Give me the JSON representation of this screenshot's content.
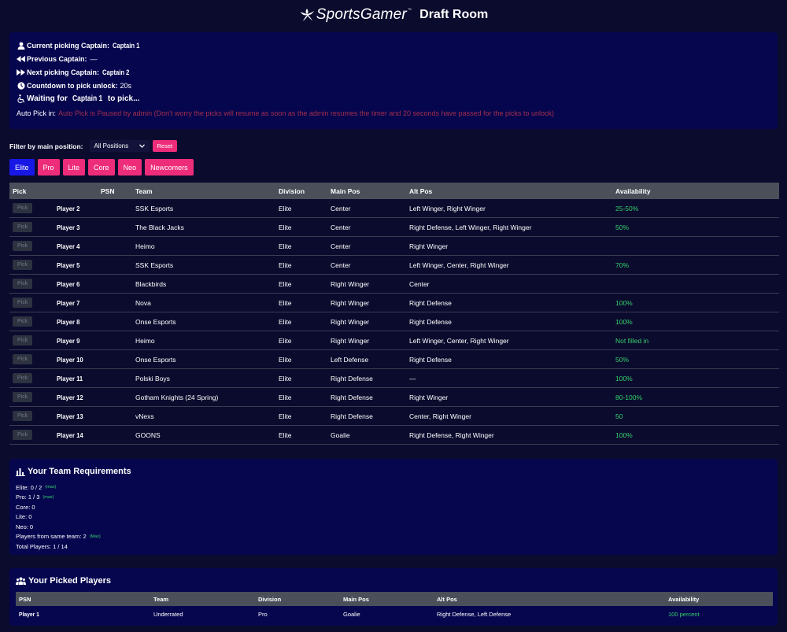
{
  "header": {
    "brand": "SportsGamer",
    "brand_tm": "™",
    "title": "Draft Room"
  },
  "status": {
    "current_label": "Current picking Captain:",
    "current_value": "Captain 1",
    "previous_label": "Previous Captain:",
    "previous_value": "—",
    "next_label": "Next picking Captain:",
    "next_value": "Captain 2",
    "countdown_label": "Countdown to pick unlock:",
    "countdown_value": "20s",
    "waiting_prefix": "Waiting for",
    "waiting_captain": "Captain 1",
    "waiting_suffix": "to pick...",
    "autopick_label": "Auto Pick in:",
    "autopick_message": "Auto Pick is Paused by admin (Don't worry the picks will resume as soon as the admin resumes the timer and 20 seconds have passed for the picks to unlock)"
  },
  "filter": {
    "label": "Filter by main position:",
    "selected": "All Positions",
    "reset_label": "Reset"
  },
  "divisions": [
    "Elite",
    "Pro",
    "Lite",
    "Core",
    "Neo",
    "Newcomers"
  ],
  "available": {
    "columns": [
      "Pick",
      "PSN",
      "Team",
      "Division",
      "Main Pos",
      "Alt Pos",
      "Availability"
    ],
    "pick_label": "Pick",
    "rows": [
      {
        "psn": "Player 2",
        "team": "SSK Esports",
        "division": "Elite",
        "main": "Center",
        "alt": "Left Winger, Right Winger",
        "avail": "25-50%"
      },
      {
        "psn": "Player 3",
        "team": "The Black Jacks",
        "division": "Elite",
        "main": "Center",
        "alt": "Right Defense, Left Winger, Right Winger",
        "avail": "50%"
      },
      {
        "psn": "Player 4",
        "team": "Heimo",
        "division": "Elite",
        "main": "Center",
        "alt": "Right Winger",
        "avail": ""
      },
      {
        "psn": "Player 5",
        "team": "SSK Esports",
        "division": "Elite",
        "main": "Center",
        "alt": "Left Winger, Center, Right Winger",
        "avail": "70%"
      },
      {
        "psn": "Player 6",
        "team": "Blackbirds",
        "division": "Elite",
        "main": "Right Winger",
        "alt": "Center",
        "avail": ""
      },
      {
        "psn": "Player 7",
        "team": "Nova",
        "division": "Elite",
        "main": "Right Winger",
        "alt": "Right Defense",
        "avail": "100%"
      },
      {
        "psn": "Player 8",
        "team": "Onse Esports",
        "division": "Elite",
        "main": "Right Winger",
        "alt": "Right Defense",
        "avail": "100%"
      },
      {
        "psn": "Player 9",
        "team": "Heimo",
        "division": "Elite",
        "main": "Right Winger",
        "alt": "Left Winger, Center, Right Winger",
        "avail": "Not filled in"
      },
      {
        "psn": "Player 10",
        "team": "Onse Esports",
        "division": "Elite",
        "main": "Left Defense",
        "alt": "Right Defense",
        "avail": "50%"
      },
      {
        "psn": "Player 11",
        "team": "Polski Boys",
        "division": "Elite",
        "main": "Right Defense",
        "alt": "—",
        "avail": "100%"
      },
      {
        "psn": "Player 12",
        "team": "Gotham Knights (24 Spring)",
        "division": "Elite",
        "main": "Right Defense",
        "alt": "Right Winger",
        "avail": "80-100%"
      },
      {
        "psn": "Player 13",
        "team": "vNexs",
        "division": "Elite",
        "main": "Right Defense",
        "alt": "Center, Right Winger",
        "avail": "50"
      },
      {
        "psn": "Player 14",
        "team": "GOONS",
        "division": "Elite",
        "main": "Goalie",
        "alt": "Right Defense, Right Winger",
        "avail": "100%"
      }
    ]
  },
  "requirements": {
    "title": "Your Team Requirements",
    "items": [
      {
        "text": "Elite: 0 / 2",
        "note": "(max)"
      },
      {
        "text": "Pro: 1 / 3",
        "note": "(max)"
      },
      {
        "text": "Core: 0",
        "note": ""
      },
      {
        "text": "Lite: 0",
        "note": ""
      },
      {
        "text": "Neo: 0",
        "note": ""
      },
      {
        "text": "Players from same team: 2",
        "note": "(Max)"
      },
      {
        "text": "Total Players: 1 / 14",
        "note": ""
      }
    ]
  },
  "picked": {
    "title": "Your Picked Players",
    "columns": [
      "PSN",
      "Team",
      "Division",
      "Main Pos",
      "Alt Pos",
      "Availability"
    ],
    "rows": [
      {
        "psn": "Player 1",
        "team": "Underrated",
        "division": "Pro",
        "main": "Goalie",
        "alt": "Right Defense, Left Defense",
        "avail": "100 percent"
      }
    ]
  },
  "colors": {
    "background": "#0b0b2e",
    "panel": "#06064f",
    "accent_pink": "#ee2d7a",
    "active_blue": "#1717e6",
    "availability_green": "#35d16a",
    "autopick_red": "#a32e4c"
  },
  "icons": {
    "brand": "sportsgamer-logo-icon",
    "current": "user-icon",
    "previous": "backward-icon",
    "next": "forward-icon",
    "countdown": "clock-icon",
    "waiting": "wheelchair-icon",
    "requirements": "bar-chart-icon",
    "picked": "users-icon"
  }
}
